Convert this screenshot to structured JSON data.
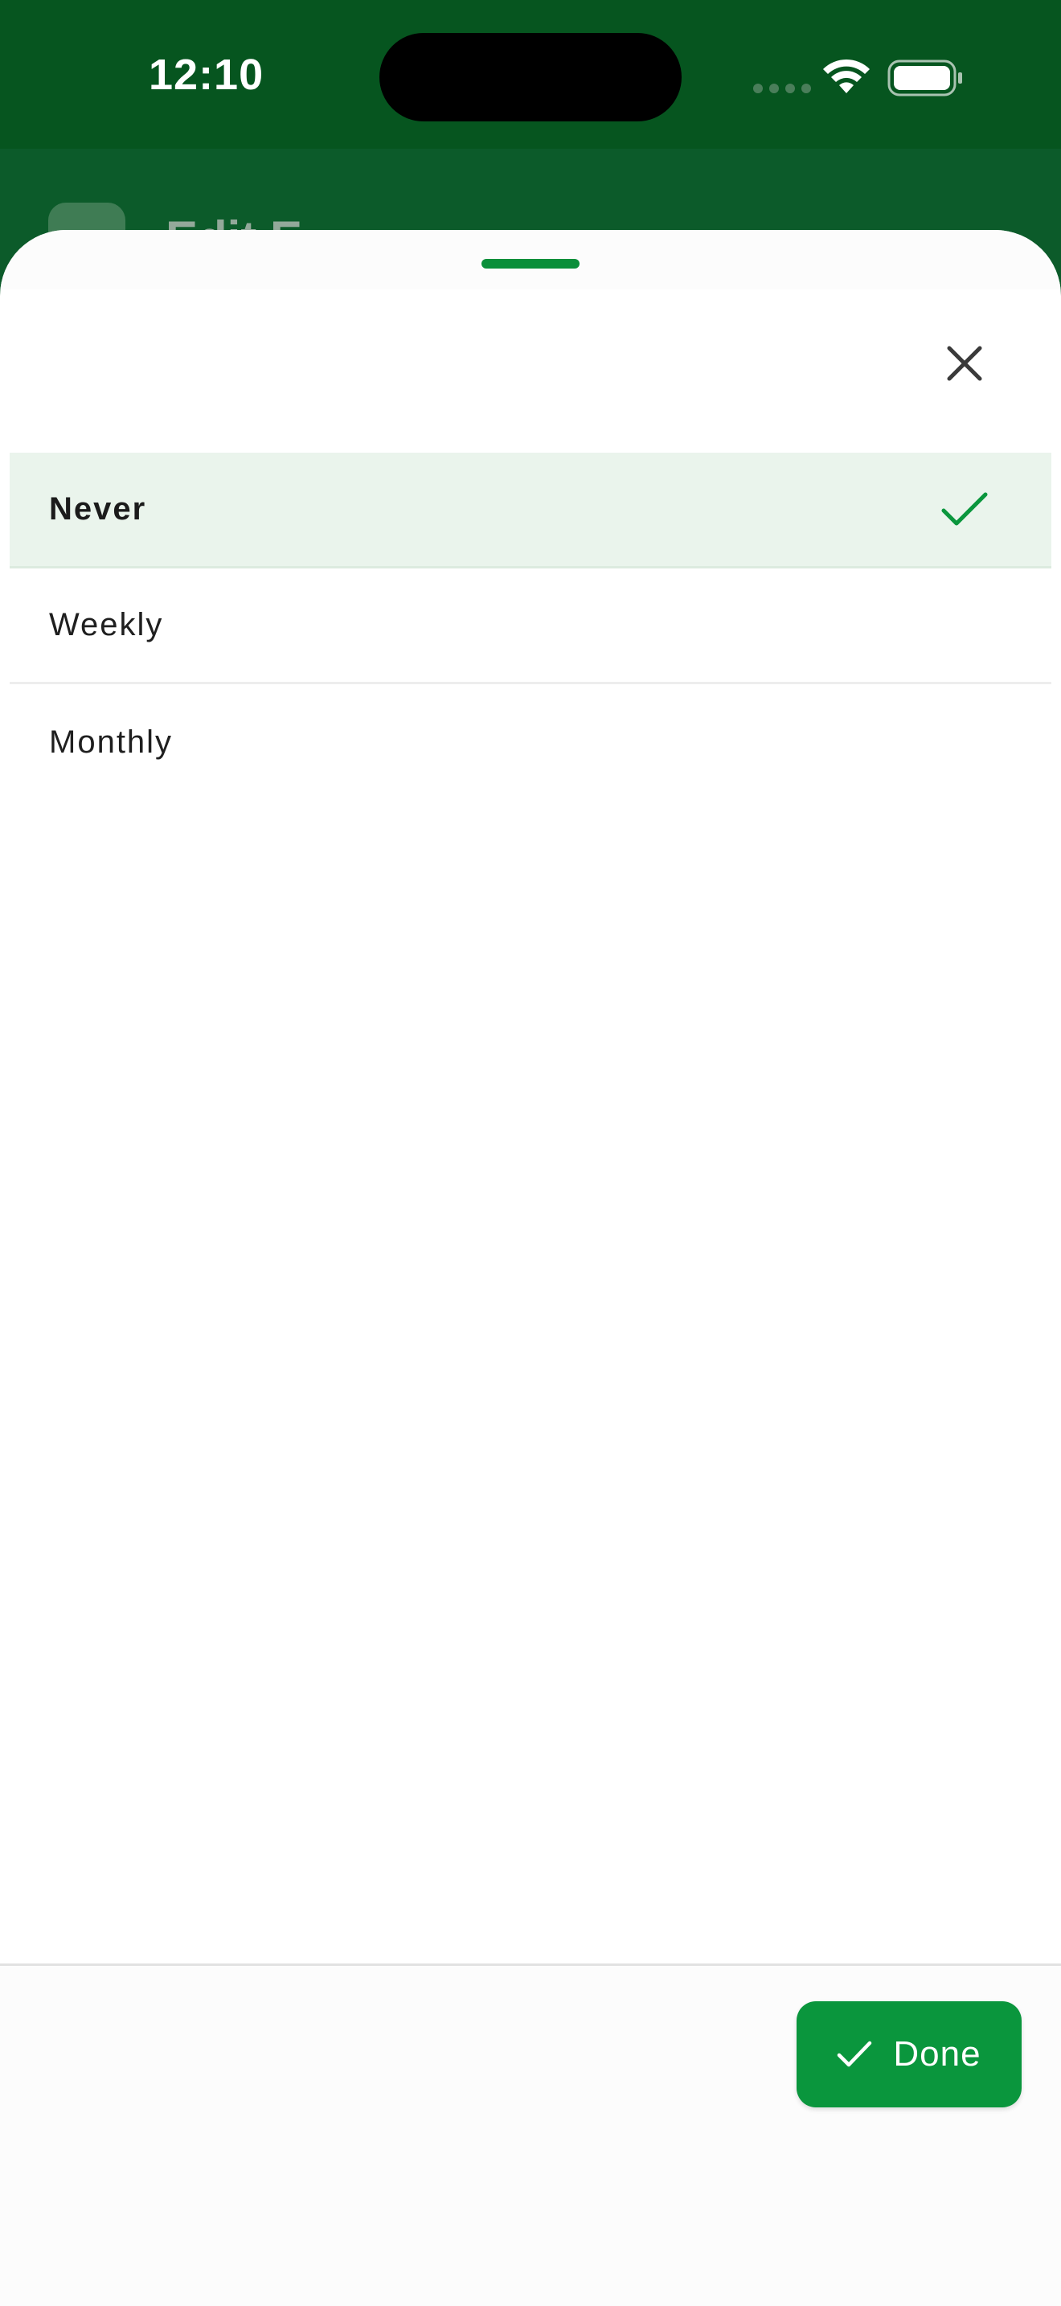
{
  "status_bar": {
    "time": "12:10"
  },
  "background": {
    "header_title": "Edit E"
  },
  "sheet": {
    "close_icon": "close-icon",
    "options": [
      {
        "label": "Never",
        "selected": true
      },
      {
        "label": "Weekly",
        "selected": false
      },
      {
        "label": "Monthly",
        "selected": false
      }
    ],
    "selected_check_icon": "check-icon",
    "done_button": {
      "label": "Done",
      "icon": "check-icon"
    }
  },
  "colors": {
    "brand_green": "#0a963d",
    "status_bar_green": "#06551f",
    "selected_row_bg": "#eaf4ec"
  }
}
